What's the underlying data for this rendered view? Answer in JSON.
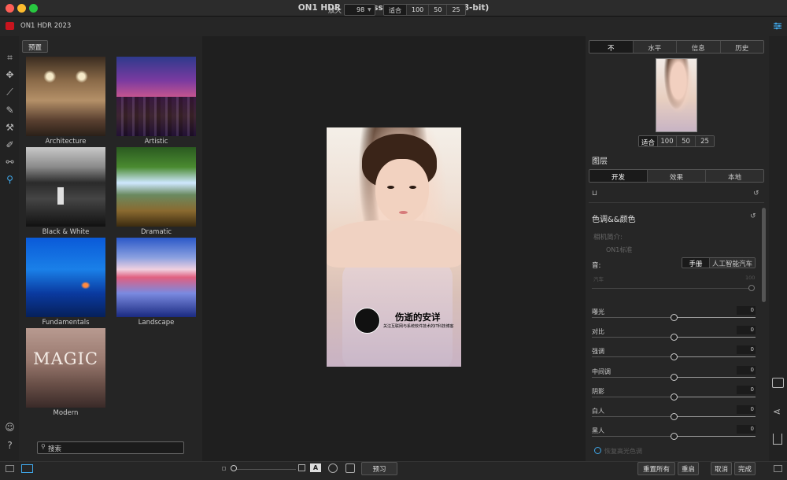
{
  "window": {
    "title": "ON1 HDR 2023 (ssdax.jpg @ 98.0% 8-bit)"
  },
  "toolbar": {
    "app_name": "ON1 HDR 2023",
    "zoom_label": "放大",
    "zoom_value": "98",
    "fit_options": [
      "适合",
      "100",
      "50",
      "25"
    ]
  },
  "presets": {
    "tab_label": "预置",
    "items": [
      "Architecture",
      "Artistic",
      "Black & White",
      "Dramatic",
      "Fundamentals",
      "Landscape",
      "Modern"
    ],
    "modern_thumb_text": "MAGIC",
    "search_placeholder": "搜索"
  },
  "canvas": {
    "watermark_title": "伤逝的安详",
    "watermark_subtitle": "关注互联网与系统软件技术的IT科技博客"
  },
  "right_panel": {
    "top_tabs": [
      "不",
      "水平",
      "信息",
      "历史"
    ],
    "nav_fit_options": [
      "适合",
      "100",
      "50",
      "25"
    ],
    "layers_title": "图层",
    "mode_tabs": [
      "开发",
      "效果",
      "本地"
    ],
    "section_title": "色调&&颜色",
    "camera_profile_label": "相机简介:",
    "camera_profile_value": "ON1标准",
    "tone_label": "音:",
    "tone_modes": [
      "手册",
      "人工智能汽车"
    ],
    "auto_label": "汽车",
    "auto_value": "100",
    "sliders": [
      {
        "label": "曝光",
        "value": "0"
      },
      {
        "label": "对比",
        "value": "0"
      },
      {
        "label": "强调",
        "value": "0"
      },
      {
        "label": "中间调",
        "value": "0"
      },
      {
        "label": "阴影",
        "value": "0"
      },
      {
        "label": "白人",
        "value": "0"
      },
      {
        "label": "黑人",
        "value": "0"
      }
    ],
    "recover_label": "恢复高光色调"
  },
  "bottom": {
    "preview_label": "预习",
    "reset_all": "重置所有",
    "reset": "重启",
    "cancel": "取消",
    "done": "完成",
    "text_badge": "A"
  },
  "colors": {
    "accent": "#3fa6e8",
    "panel": "#262626",
    "canvas": "#1f1f1f"
  }
}
